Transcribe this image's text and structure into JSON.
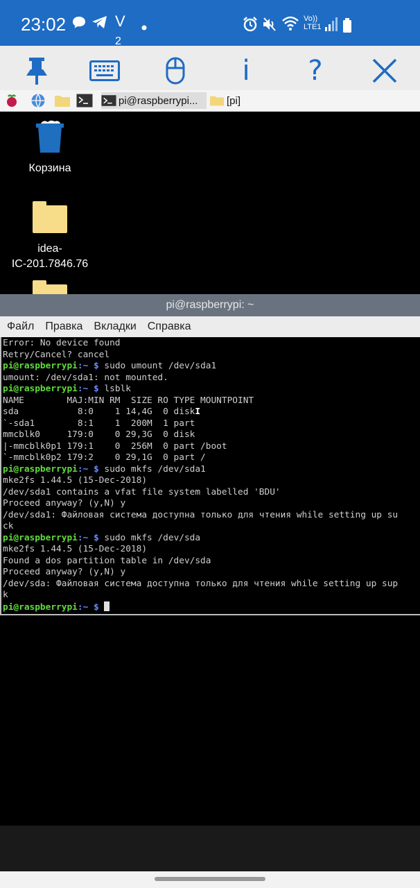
{
  "statusbar": {
    "time": "23:02",
    "lte_top": "Vo))",
    "lte_bottom": "LTE1",
    "vr": "V",
    "vr2": "2"
  },
  "vnc_toolbar": {
    "pin": "pin-icon",
    "keyboard": "keyboard-icon",
    "mouse": "mouse-icon",
    "info": "i",
    "help": "?",
    "close": "×"
  },
  "taskbar": {
    "terminal_task": "pi@raspberrypi...",
    "files_task": "[pi]"
  },
  "desktop": {
    "trash_label": "Корзина",
    "folder1_label_line1": "idea-",
    "folder1_label_line2": "IC-201.7846.76"
  },
  "terminal": {
    "title": "pi@raspberrypi: ~",
    "menu": [
      "Файл",
      "Правка",
      "Вкладки",
      "Справка"
    ],
    "prompt_user": "pi@raspberrypi",
    "prompt_path": ":~ $",
    "lines": {
      "l1": "Error: No device found",
      "l2": "Retry/Cancel? cancel",
      "cmd1": " sudo umount /dev/sda1",
      "l3": "umount: /dev/sda1: not mounted.",
      "cmd2": " lsblk",
      "l4": "NAME        MAJ:MIN RM  SIZE RO TYPE MOUNTPOINT",
      "l5": "sda           8:0    1 14,4G  0 disk",
      "l6": "`-sda1        8:1    1  200M  1 part",
      "l7": "mmcblk0     179:0    0 29,3G  0 disk",
      "l8": "|-mmcblk0p1 179:1    0  256M  0 part /boot",
      "l9": "`-mmcblk0p2 179:2    0 29,1G  0 part /",
      "cmd3": " sudo mkfs /dev/sda1",
      "l10": "mke2fs 1.44.5 (15-Dec-2018)",
      "l11": "/dev/sda1 contains a vfat file system labelled 'BDU'",
      "l12": "Proceed anyway? (y,N) y",
      "l13": "/dev/sda1: Файловая система доступна только для чтения while setting up su",
      "l14": "ck",
      "cmd4": " sudo mkfs /dev/sda",
      "l15": "mke2fs 1.44.5 (15-Dec-2018)",
      "l16": "Found a dos partition table in /dev/sda",
      "l17": "Proceed anyway? (y,N) y",
      "l18": "/dev/sda: Файловая система доступна только для чтения while setting up sup",
      "l19": "k"
    }
  },
  "colors": {
    "statusbar": "#1e6cc4",
    "toolbar_icons": "#1e6cc4",
    "prompt_user": "#5fdc3c",
    "prompt_path": "#6b8cff"
  }
}
